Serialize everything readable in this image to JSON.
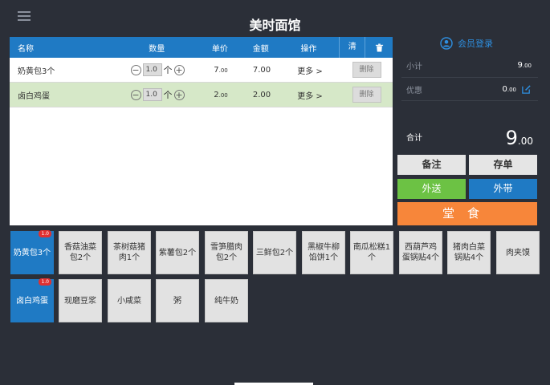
{
  "header": {
    "title": "美时面馆"
  },
  "order_table": {
    "columns": {
      "name": "名称",
      "qty": "数量",
      "price": "单价",
      "amount": "金额",
      "ops": "操作",
      "clear": "清"
    },
    "rows": [
      {
        "name": "奶黄包3个",
        "qty": "1.0",
        "unit": "个",
        "price_int": "7",
        "price_dec": ".00",
        "amount": "7.00",
        "more": "更多 >",
        "delete": "删除"
      },
      {
        "name": "卤白鸡蛋",
        "qty": "1.0",
        "unit": "个",
        "price_int": "2",
        "price_dec": ".00",
        "amount": "2.00",
        "more": "更多 >",
        "delete": "删除"
      }
    ]
  },
  "summary": {
    "member_login": "会员登录",
    "subtotal_label": "小计",
    "subtotal_int": "9",
    "subtotal_dec": ".00",
    "discount_label": "优惠",
    "discount_int": "0",
    "discount_dec": ".00",
    "total_label": "合计",
    "total_int": "9",
    "total_dec": ".00"
  },
  "actions": {
    "note": "备注",
    "save": "存单",
    "deliver": "外送",
    "takeaway": "外带",
    "dine_in": "堂食"
  },
  "products": [
    {
      "name": "奶黄包3个",
      "badge": "1.0"
    },
    {
      "name": "香菇油菜包2个"
    },
    {
      "name": "茶树菇猪肉1个"
    },
    {
      "name": "紫薯包2个"
    },
    {
      "name": "雪笋腊肉包2个"
    },
    {
      "name": "三鲜包2个"
    },
    {
      "name": "黑椒牛柳馅饼1个"
    },
    {
      "name": "南瓜松糕1个"
    },
    {
      "name": "西葫芦鸡蛋锅贴4个"
    },
    {
      "name": "猪肉白菜锅贴4个"
    },
    {
      "name": "肉夹馍"
    },
    {
      "name": "卤白鸡蛋",
      "badge": "1.0"
    },
    {
      "name": "现磨豆浆"
    },
    {
      "name": "小咸菜"
    },
    {
      "name": "粥"
    },
    {
      "name": "纯牛奶"
    }
  ],
  "colors": {
    "accent": "#1f7ac4",
    "green": "#6cc244",
    "orange": "#f7863a",
    "selected_row": "#d6e8c8",
    "background": "#2b2f38"
  },
  "icons": {
    "menu": "menu-icon",
    "trash": "trash-icon",
    "user": "user-icon",
    "edit": "edit-icon"
  }
}
